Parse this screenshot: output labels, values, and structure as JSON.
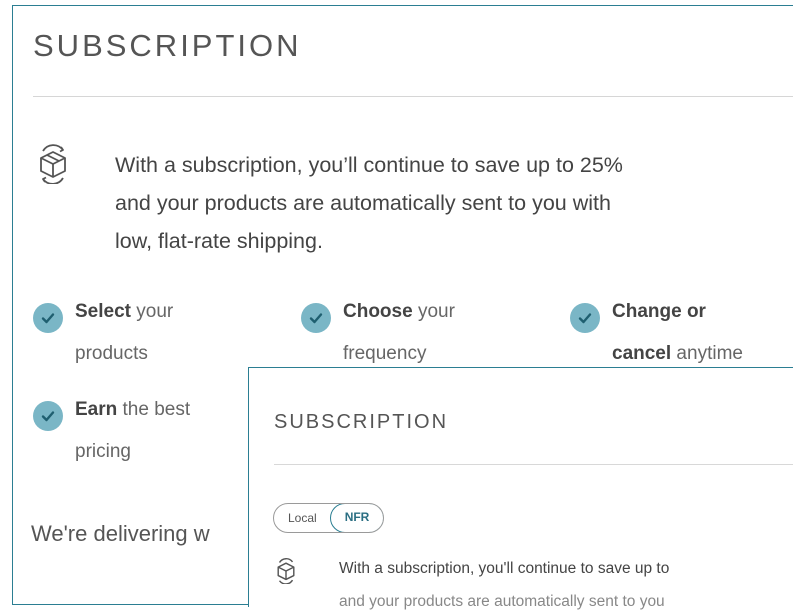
{
  "main": {
    "title": "SUBSCRIPTION",
    "intro_lines": [
      "With a subscription, you’ll continue to save up to 25%",
      "and your products are automatically sent to you with",
      "low, flat-rate shipping."
    ],
    "benefits": [
      {
        "bold": "Select",
        "rest": " your",
        "line2": "products"
      },
      {
        "bold": "Choose",
        "rest": " your",
        "line2": "frequency"
      },
      {
        "bold": "Change or",
        "rest": "",
        "line2_bold": "cancel",
        "line2": " anytime"
      },
      {
        "bold": "Earn",
        "rest": " the best",
        "line2": "pricing"
      }
    ],
    "delivering_text": "We're delivering w"
  },
  "inset": {
    "title": "SUBSCRIPTION",
    "toggle": {
      "options": [
        "Local",
        "NFR"
      ],
      "selected": "NFR"
    },
    "intro_text": "With a subscription, you'll continue to save up to",
    "intro_text_partial": "and your products are automatically sent to you"
  },
  "colors": {
    "border": "#2b7e92",
    "check_bg": "#7ab6c6",
    "text": "#444444"
  },
  "icons": [
    "box-subscription-icon",
    "check-circle-icon"
  ]
}
